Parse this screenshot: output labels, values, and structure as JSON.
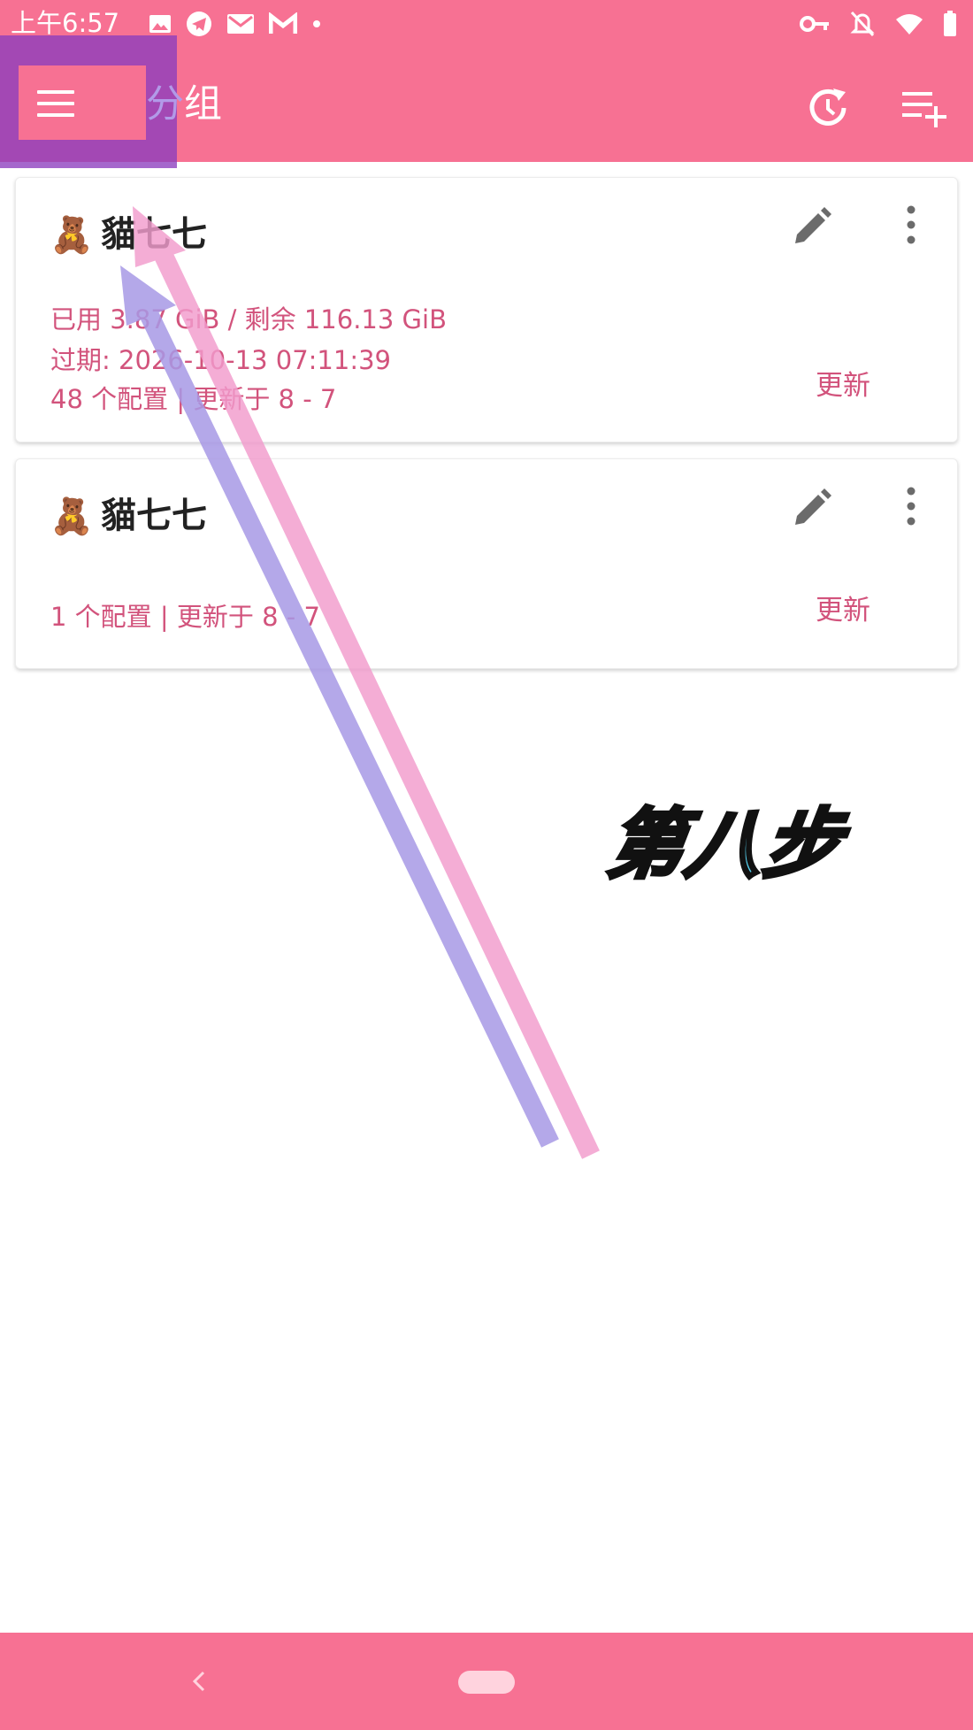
{
  "status_bar": {
    "time": "上午6:57",
    "left_icons": [
      "image-icon",
      "telegram-icon",
      "gmail-icon",
      "gmail-icon",
      "dot-icon"
    ],
    "right_icons": [
      "vpn-key-icon",
      "bell-off-icon",
      "wifi-icon",
      "battery-icon"
    ]
  },
  "app_bar": {
    "title_first": "分",
    "title_rest": "组",
    "menu_icon": "menu-icon",
    "actions": [
      "history-icon",
      "playlist-add-icon"
    ]
  },
  "subscriptions": [
    {
      "emoji": "🧸",
      "name": "貓七七",
      "usage": "已用 3.87 GiB / 剩余 116.13 GiB",
      "expiry": "过期: 2026-10-13 07:11:39",
      "summary": "48 个配置 | 更新于 8 - 7",
      "update_label": "更新"
    },
    {
      "emoji": "🧸",
      "name": "貓七七",
      "summary": "1 个配置 | 更新于 8 - 7",
      "update_label": "更新"
    }
  ],
  "annotation": {
    "step_label": "第八步"
  },
  "colors": {
    "primary": "#f77193",
    "accent_text": "#d2537c",
    "highlight_box": "#8c3cbe",
    "arrow_pink": "#f29ccd",
    "arrow_purple": "#a899e6",
    "step_text": "#57d3f2"
  }
}
